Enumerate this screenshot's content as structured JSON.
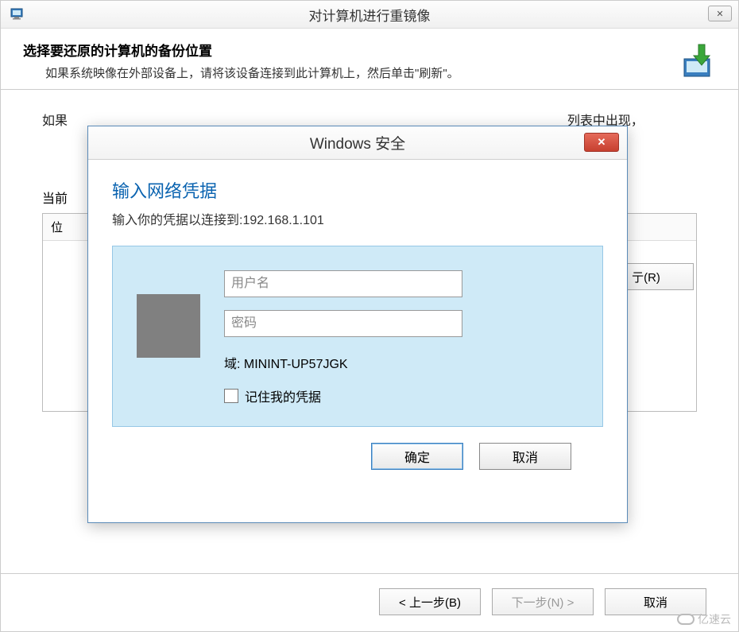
{
  "main": {
    "title": "对计算机进行重镜像",
    "heading": "选择要还原的计算机的备份位置",
    "subheading": "如果系统映像在外部设备上，请将该设备连接到此计算机上，然后单击\"刷新\"。",
    "hint_before": "如果",
    "hint_after": "列表中出现，",
    "current_label": "当前",
    "location_header": "位",
    "side_button": "亍(R)",
    "back_button": "< 上一步(B)",
    "next_button": "下一步(N) >",
    "cancel_button": "取消"
  },
  "cred": {
    "title": "Windows 安全",
    "heading": "输入网络凭据",
    "subtext": "输入你的凭据以连接到:192.168.1.101",
    "username_placeholder": "用户名",
    "password_placeholder": "密码",
    "domain_label": "域:",
    "domain_value": "MININT-UP57JGK",
    "remember_label": "记住我的凭据",
    "ok_button": "确定",
    "cancel_button": "取消"
  },
  "watermark": "亿速云"
}
